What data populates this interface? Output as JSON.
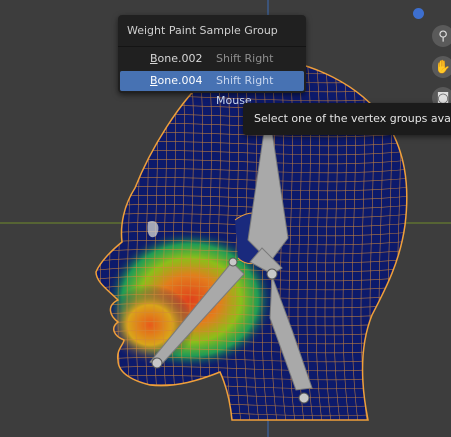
{
  "menu": {
    "title": "Weight Paint Sample Group",
    "items": [
      {
        "label": "Bone.002",
        "shortcut": "Shift Right Mouse",
        "active": false
      },
      {
        "label": "Bone.004",
        "shortcut": "Shift Right Mouse",
        "active": true
      }
    ]
  },
  "tooltip": {
    "text": "Select one of the vertex groups available under current mouse position"
  },
  "viewport_tools": [
    {
      "icon": "zoom-icon",
      "glyph": "⚲"
    },
    {
      "icon": "hand-icon",
      "glyph": "✋"
    },
    {
      "icon": "camera-icon",
      "glyph": "◙"
    }
  ],
  "colors": {
    "background": "#3d3d3d",
    "wire": "#d38a3a",
    "mesh_base": "#0d1a6b",
    "bone": "#a9a9a9",
    "highlight": "#4772b3",
    "axis_x": "#6e8a2a",
    "axis_y": "#3a6cb8"
  }
}
